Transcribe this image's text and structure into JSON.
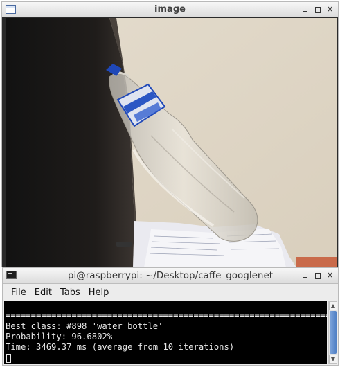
{
  "image_window": {
    "title": "image",
    "controls": {
      "minimize": "minimize-icon",
      "maximize": "maximize-icon",
      "close": "close-icon"
    }
  },
  "terminal_window": {
    "title": "pi@raspberrypi: ~/Desktop/caffe_googlenet",
    "menu": [
      {
        "label": "File",
        "mnemonic": "F",
        "rest": "ile"
      },
      {
        "label": "Edit",
        "mnemonic": "E",
        "rest": "dit"
      },
      {
        "label": "Tabs",
        "mnemonic": "T",
        "rest": "abs"
      },
      {
        "label": "Help",
        "mnemonic": "H",
        "rest": "elp"
      }
    ],
    "lines": [
      "=================================================================",
      "Best class: #898 'water bottle'",
      "Probability: 96.6802%",
      "Time: 3469.37 ms (average from 10 iterations)"
    ]
  }
}
